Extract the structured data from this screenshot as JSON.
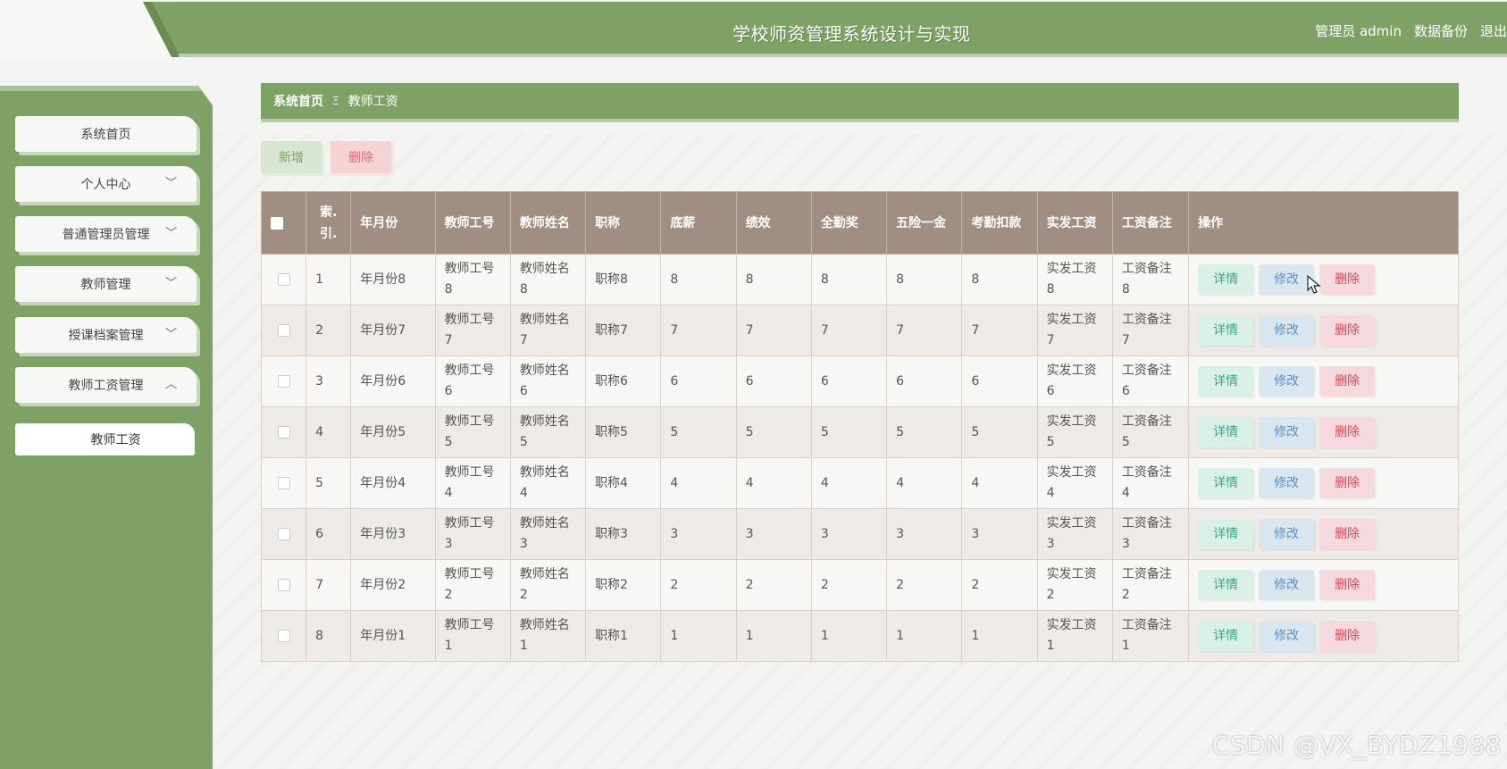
{
  "header": {
    "title": "学校师资管理系统设计与实现",
    "user_label": "管理员 admin",
    "backup_label": "数据备份",
    "logout_label": "退出"
  },
  "sidebar": {
    "items": [
      {
        "label": "系统首页",
        "chevron": ""
      },
      {
        "label": "个人中心",
        "chevron": "﹀"
      },
      {
        "label": "普通管理员管理",
        "chevron": "﹀"
      },
      {
        "label": "教师管理",
        "chevron": "﹀"
      },
      {
        "label": "授课档案管理",
        "chevron": "﹀"
      },
      {
        "label": "教师工资管理",
        "chevron": "︿"
      }
    ],
    "subitem": "教师工资"
  },
  "breadcrumb": {
    "home": "系统首页",
    "separator": "Ξ",
    "current": "教师工资"
  },
  "actions": {
    "add_label": "新增",
    "delete_label": "删除"
  },
  "table": {
    "headers": [
      "索.引.",
      "年月份",
      "教师工号",
      "教师姓名",
      "职称",
      "底薪",
      "绩效",
      "全勤奖",
      "五险一金",
      "考勤扣款",
      "实发工资",
      "工资备注",
      "操作"
    ],
    "rows": [
      [
        "1",
        "年月份8",
        "教师工号8",
        "教师姓名8",
        "职称8",
        "8",
        "8",
        "8",
        "8",
        "8",
        "实发工资8",
        "工资备注8"
      ],
      [
        "2",
        "年月份7",
        "教师工号7",
        "教师姓名7",
        "职称7",
        "7",
        "7",
        "7",
        "7",
        "7",
        "实发工资7",
        "工资备注7"
      ],
      [
        "3",
        "年月份6",
        "教师工号6",
        "教师姓名6",
        "职称6",
        "6",
        "6",
        "6",
        "6",
        "6",
        "实发工资6",
        "工资备注6"
      ],
      [
        "4",
        "年月份5",
        "教师工号5",
        "教师姓名5",
        "职称5",
        "5",
        "5",
        "5",
        "5",
        "5",
        "实发工资5",
        "工资备注5"
      ],
      [
        "5",
        "年月份4",
        "教师工号4",
        "教师姓名4",
        "职称4",
        "4",
        "4",
        "4",
        "4",
        "4",
        "实发工资4",
        "工资备注4"
      ],
      [
        "6",
        "年月份3",
        "教师工号3",
        "教师姓名3",
        "职称3",
        "3",
        "3",
        "3",
        "3",
        "3",
        "实发工资3",
        "工资备注3"
      ],
      [
        "7",
        "年月份2",
        "教师工号2",
        "教师姓名2",
        "职称2",
        "2",
        "2",
        "2",
        "2",
        "2",
        "实发工资2",
        "工资备注2"
      ],
      [
        "8",
        "年月份1",
        "教师工号1",
        "教师姓名1",
        "职称1",
        "1",
        "1",
        "1",
        "1",
        "1",
        "实发工资1",
        "工资备注1"
      ]
    ],
    "row_actions": {
      "detail": "详情",
      "edit": "修改",
      "delete": "删除"
    }
  },
  "watermark": "CSDN @VX_BYDZ1988",
  "colors": {
    "primary_green": "#7ea265",
    "table_header": "#a08e82",
    "detail_btn": "#d9f0e7",
    "edit_btn": "#dae6ef",
    "delete_btn": "#f6d9dc"
  }
}
